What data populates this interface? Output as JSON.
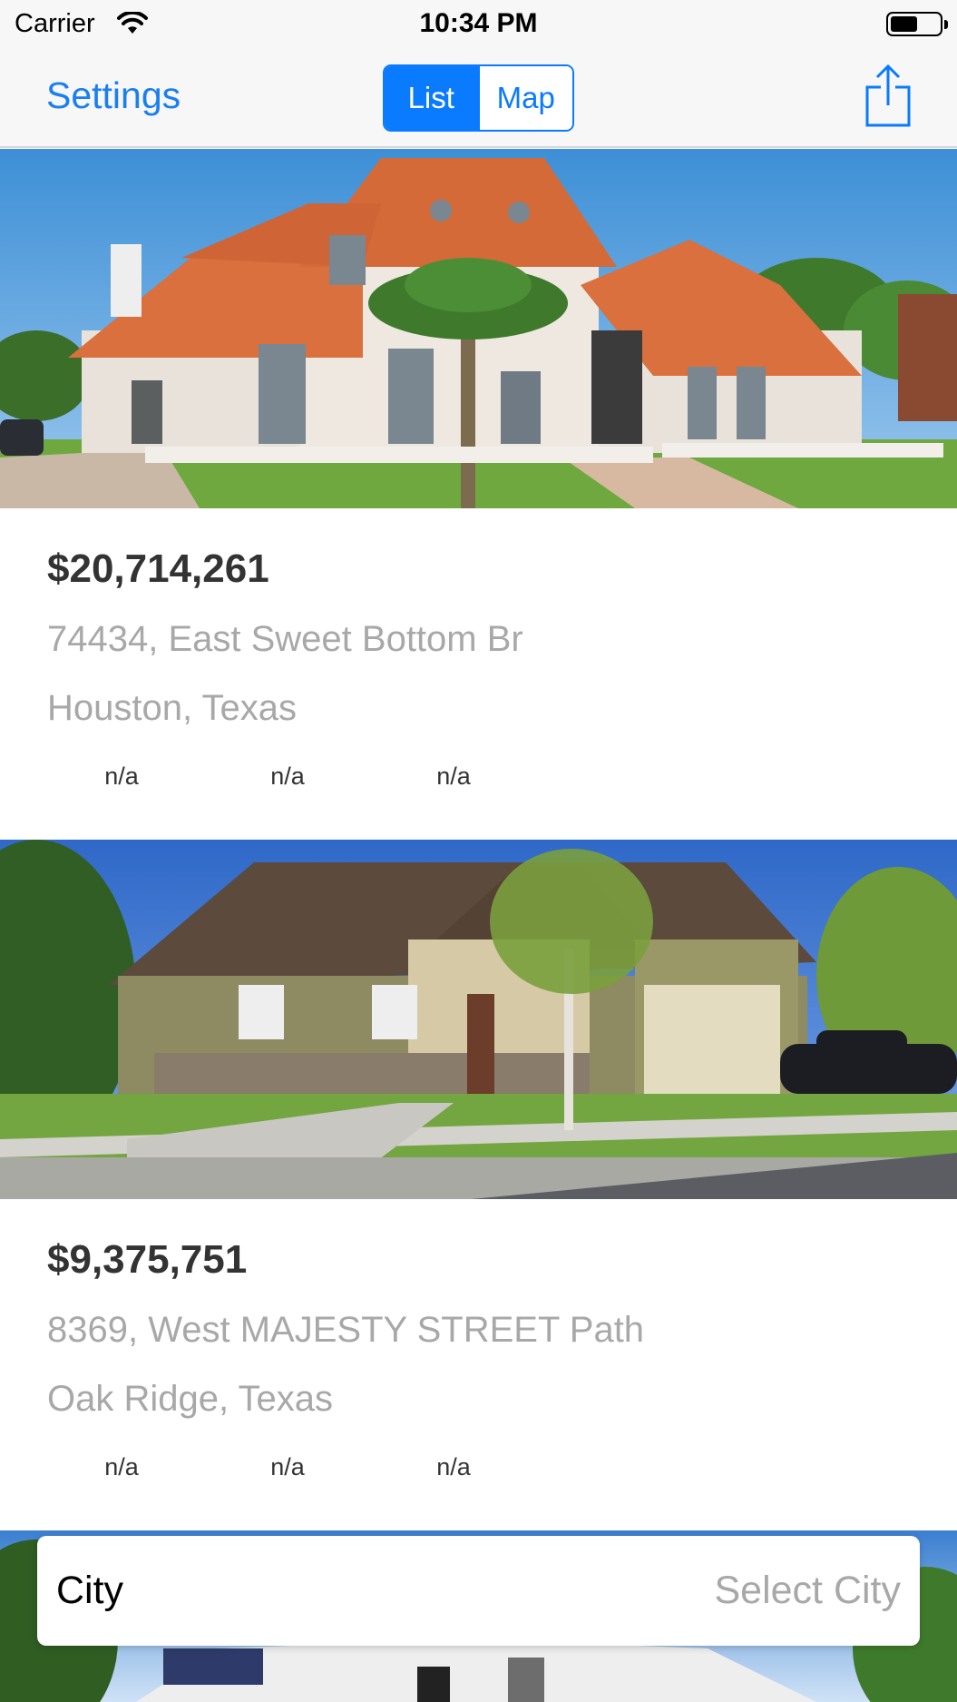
{
  "status_bar": {
    "carrier": "Carrier",
    "time": "10:34 PM",
    "battery_level": 0.55
  },
  "nav": {
    "settings_label": "Settings",
    "segments": [
      "List",
      "Map"
    ],
    "selected_segment": "List",
    "share_icon": "share-icon"
  },
  "listings": [
    {
      "price": "$20,714,261",
      "address_line1": "74434, East Sweet Bottom Br",
      "address_line2": "Houston, Texas",
      "stats": [
        "n/a",
        "n/a",
        "n/a"
      ]
    },
    {
      "price": "$9,375,751",
      "address_line1": "8369, West MAJESTY STREET Path",
      "address_line2": "Oak Ridge, Texas",
      "stats": [
        "n/a",
        "n/a",
        "n/a"
      ]
    }
  ],
  "city_picker": {
    "label": "City",
    "placeholder": "Select City"
  },
  "colors": {
    "accent": "#0a7aff",
    "secondary_text": "#a8a8a8",
    "price_text": "#333333"
  }
}
